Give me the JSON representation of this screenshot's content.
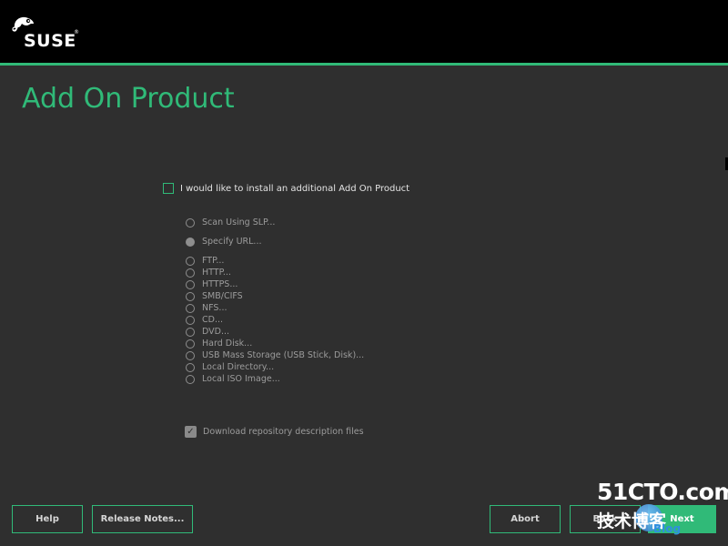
{
  "header": {
    "brand": "SUSE",
    "trademark": "®"
  },
  "colors": {
    "accent": "#30ba78",
    "background": "#2f2f2f",
    "topbar": "#000000"
  },
  "page": {
    "title": "Add On Product"
  },
  "main_checkbox": {
    "label": "I would like to install an additional Add On Product",
    "checked": false
  },
  "sources": [
    {
      "label": "Scan Using SLP...",
      "selected": false
    },
    {
      "label": "Specify URL...",
      "selected": true
    },
    {
      "label": "FTP...",
      "selected": false
    },
    {
      "label": "HTTP...",
      "selected": false
    },
    {
      "label": "HTTPS...",
      "selected": false
    },
    {
      "label": "SMB/CIFS",
      "selected": false
    },
    {
      "label": "NFS...",
      "selected": false
    },
    {
      "label": "CD...",
      "selected": false
    },
    {
      "label": "DVD...",
      "selected": false
    },
    {
      "label": "Hard Disk...",
      "selected": false
    },
    {
      "label": "USB Mass Storage (USB Stick, Disk)...",
      "selected": false
    },
    {
      "label": "Local Directory...",
      "selected": false
    },
    {
      "label": "Local ISO Image...",
      "selected": false
    }
  ],
  "download_checkbox": {
    "label": "Download repository description files",
    "checked": true
  },
  "buttons": {
    "help": "Help",
    "release_notes": "Release Notes...",
    "abort": "Abort",
    "back": "Back",
    "next": "Next"
  },
  "watermark": {
    "main": "51CTO.com",
    "sub": "技术博客",
    "blog": "Blog"
  }
}
